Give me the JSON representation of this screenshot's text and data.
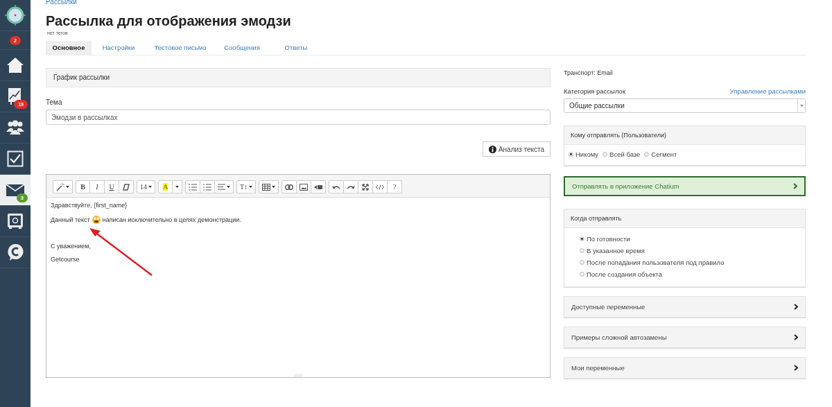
{
  "sidebar": {
    "items": [
      {
        "selected": false
      },
      {
        "badge": "2",
        "color": "#d9312b",
        "selected": false
      },
      {
        "selected": false
      },
      {
        "badge": "19",
        "color": "#d9312b",
        "selected": false
      },
      {
        "selected": false
      },
      {
        "selected": false
      },
      {
        "badge": "3",
        "color": "#5c9a2e",
        "selected": true
      },
      {
        "selected": false
      },
      {
        "selected": false
      }
    ]
  },
  "breadcrumb": "Рассылки",
  "title": "Рассылка для отображения эмодзи",
  "tags": "нет тегов",
  "tabs": [
    {
      "label": "Основное",
      "selected": true
    },
    {
      "label": "Настройки",
      "selected": false
    },
    {
      "label": "Тестовое письмо",
      "selected": false
    },
    {
      "label": "Сообщения",
      "selected": false
    },
    {
      "label": "Ответы",
      "selected": false
    }
  ],
  "schedule_panel": "График рассылки",
  "subject": {
    "label": "Тема",
    "value": "Эмодзи в рассылках"
  },
  "analyze_button": "Анализ текста",
  "editor": {
    "toolbar_labels": [
      "B",
      "I",
      "U",
      "14",
      "A",
      "T↕",
      "?"
    ],
    "greeting": "Здравствуйте, {first_name}",
    "sentence_before": "Данный текст",
    "sentence_after": "написан исключительно в целях демонстрации.",
    "closing": "С уважением,",
    "signature": "Getcourse"
  },
  "transport": "Транспорт: Email",
  "category": {
    "label": "Категория рассылок",
    "link": "Управление рассылками",
    "value": "Общие рассылки"
  },
  "recipients": {
    "title": "Кому отправлять (Пользователи)",
    "options": [
      {
        "label": "Никому",
        "selected": true
      },
      {
        "label": "Всей базе",
        "selected": false
      },
      {
        "label": "Сегмент",
        "selected": false
      }
    ]
  },
  "chatium": "Отправлять в приложение Chatium",
  "when": {
    "title": "Когда отправлять",
    "options": [
      {
        "label": "По готовности",
        "selected": true
      },
      {
        "label": "В указанное время",
        "selected": false
      },
      {
        "label": "После попадания пользователя под правило",
        "selected": false
      },
      {
        "label": "После создания объекта",
        "selected": false
      }
    ]
  },
  "accordions": [
    "Доступные переменные",
    "Примеры сложной автозамены",
    "Мои переменные"
  ]
}
